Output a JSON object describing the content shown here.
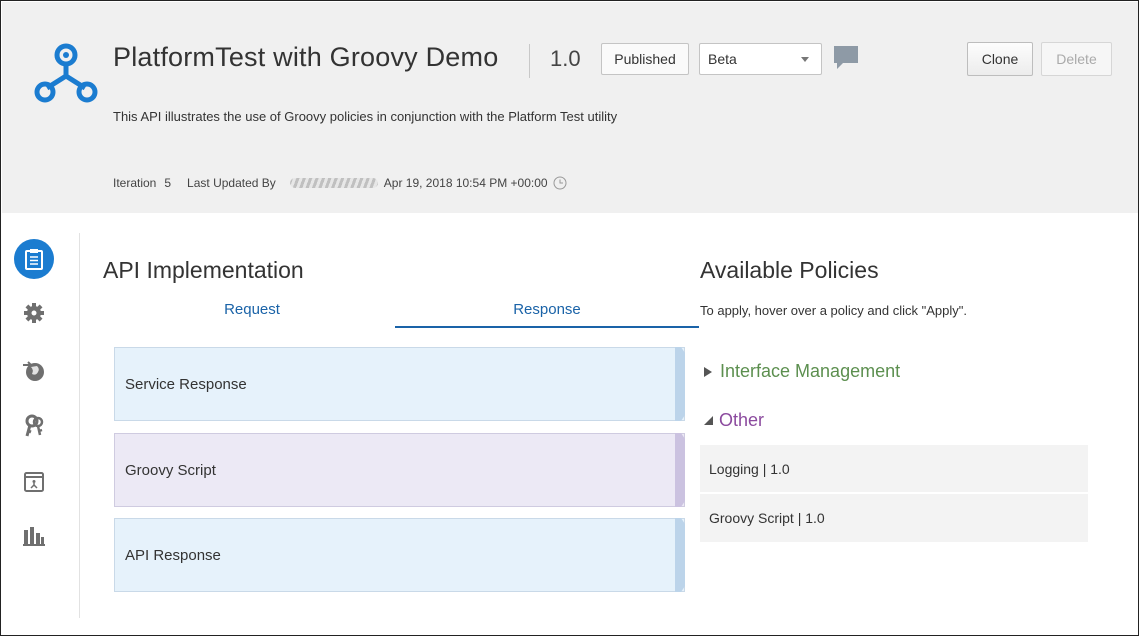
{
  "header": {
    "title": "PlatformTest with Groovy Demo",
    "version": "1.0",
    "status_badge": "Published",
    "stage_select": "Beta",
    "clone_label": "Clone",
    "delete_label": "Delete",
    "description": "This API illustrates the use of Groovy policies in conjunction with the Platform Test utility",
    "iteration_label": "Iteration",
    "iteration_value": "5",
    "last_updated_label": "Last Updated By",
    "last_updated_time": "Apr 19, 2018 10:54 PM +00:00"
  },
  "sidebar": {
    "items": [
      {
        "icon": "api-implementation-icon",
        "active": true
      },
      {
        "icon": "gear-icon"
      },
      {
        "icon": "globe-deploy-icon"
      },
      {
        "icon": "keys-icon"
      },
      {
        "icon": "portal-icon"
      },
      {
        "icon": "analytics-icon"
      }
    ]
  },
  "implementation": {
    "title": "API Implementation",
    "tabs": [
      "Request",
      "Response"
    ],
    "active_tab": "Response",
    "flow": [
      {
        "label": "Service Response",
        "color": "#e6f2fb"
      },
      {
        "label": "Groovy Script",
        "color": "#ece9f5"
      },
      {
        "label": "API Response",
        "color": "#e6f2fb"
      }
    ]
  },
  "policies": {
    "title": "Available Policies",
    "hint": "To apply, hover over a policy and click \"Apply\".",
    "groups": [
      {
        "label": "Interface Management",
        "expanded": false,
        "color": "#5c8f4f"
      },
      {
        "label": "Other",
        "expanded": true,
        "color": "#8b4a9e"
      }
    ],
    "items": [
      "Logging | 1.0",
      "Groovy Script | 1.0"
    ]
  },
  "colors": {
    "accent": "#1b7cd0",
    "header_bg": "#f0f0f0"
  }
}
